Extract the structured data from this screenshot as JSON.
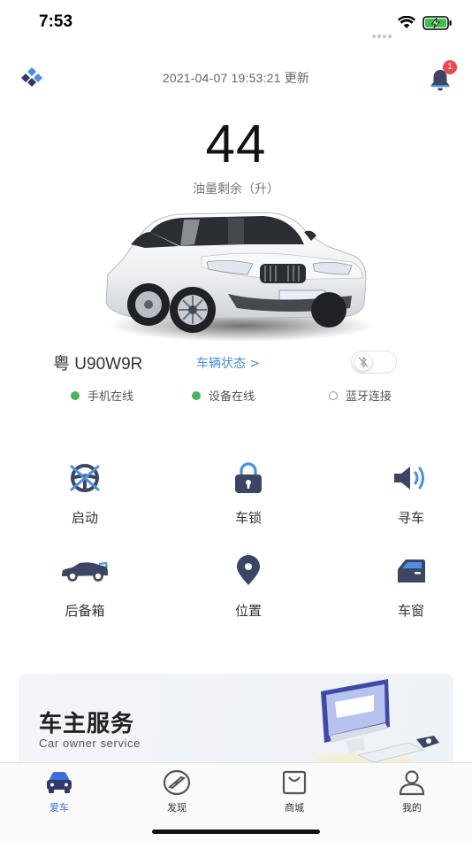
{
  "status_bar": {
    "time": "7:53"
  },
  "header": {
    "update_time": "2021-04-07 19:53:21 更新",
    "notification_count": "1"
  },
  "fuel": {
    "value": "44",
    "label": "油量剩余（升）"
  },
  "vehicle": {
    "plate": "粤 U90W9R",
    "status_link": "车辆状态 >"
  },
  "connections": [
    {
      "label": "手机在线",
      "online": true
    },
    {
      "label": "设备在线",
      "online": true
    },
    {
      "label": "蓝牙连接",
      "online": false
    }
  ],
  "controls": [
    {
      "label": "启动",
      "icon": "start-engine-icon"
    },
    {
      "label": "车锁",
      "icon": "lock-icon"
    },
    {
      "label": "寻车",
      "icon": "speaker-icon"
    },
    {
      "label": "后备箱",
      "icon": "trunk-car-icon"
    },
    {
      "label": "位置",
      "icon": "location-pin-icon"
    },
    {
      "label": "车窗",
      "icon": "car-window-icon"
    }
  ],
  "service": {
    "title": "车主服务",
    "subtitle": "Car owner service"
  },
  "tabs": [
    {
      "label": "爱车",
      "icon": "car-icon",
      "active": true
    },
    {
      "label": "发现",
      "icon": "compass-icon",
      "active": false
    },
    {
      "label": "商城",
      "icon": "shopping-bag-icon",
      "active": false
    },
    {
      "label": "我的",
      "icon": "person-icon",
      "active": false
    }
  ],
  "colors": {
    "accent": "#4a8fe0",
    "online": "#44b95c",
    "badge": "#ef4a4a",
    "icon": "#3c4664"
  }
}
